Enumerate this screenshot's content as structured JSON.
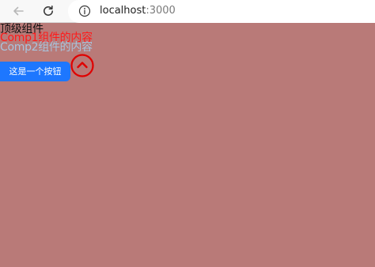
{
  "browser": {
    "url_host": "localhost",
    "url_port": ":3000",
    "back_icon": "back-arrow-icon",
    "reload_icon": "reload-icon",
    "info_icon": "info-icon"
  },
  "page": {
    "top_title": "顶级组件",
    "comp1_text": "Comp1组件的内容",
    "comp2_text": "Comp2组件的内容",
    "button_label": "这是一个按钮",
    "up_button_icon": "chevron-up-icon"
  },
  "colors": {
    "page_background": "#b97a78",
    "comp1_text": "#ff1a1a",
    "comp2_text": "#a8c4dd",
    "button_background": "#1d77ff",
    "circle_icon": "#e00000"
  }
}
